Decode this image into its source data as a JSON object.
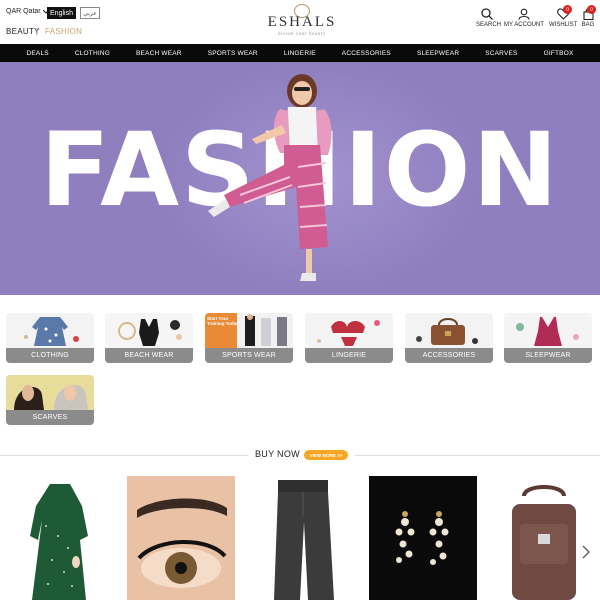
{
  "header": {
    "country": "QAR Qatar",
    "lang_en": "English",
    "lang_ar": "عربي",
    "cat_beauty": "BEAUTY",
    "cat_sep": "|",
    "cat_fashion": "FASHION",
    "logo_text": "ESHALS",
    "logo_tag": "bloom your beauty",
    "search_label": "SEARCH",
    "account_label": "MY ACCOUNT",
    "wishlist_label": "WISHLIST",
    "wishlist_count": "0",
    "bag_label": "BAG",
    "bag_count": "0"
  },
  "nav": [
    "DEALS",
    "CLOTHING",
    "BEACH WEAR",
    "SPORTS WEAR",
    "LINGERIE",
    "ACCESSORIES",
    "SLEEPWEAR",
    "SCARVES",
    "GIFTBOX"
  ],
  "hero": {
    "text": "FASHION"
  },
  "categories": [
    {
      "label": "CLOTHING"
    },
    {
      "label": "BEACH WEAR"
    },
    {
      "label": "SPORTS WEAR",
      "thumb_text": "Start Your Training Today"
    },
    {
      "label": "LINGERIE"
    },
    {
      "label": "ACCESSORIES"
    },
    {
      "label": "SLEEPWEAR"
    },
    {
      "label": "SCARVES"
    }
  ],
  "buy_now": {
    "title": "BUY NOW",
    "view_more": "VIEW MORE >>"
  },
  "colors": {
    "accent": "#f5a623",
    "hero_bg": "#8f7fbf",
    "nav_bg": "#0a0a0a",
    "badge": "#e02020",
    "fashion": "#c9a46a"
  }
}
